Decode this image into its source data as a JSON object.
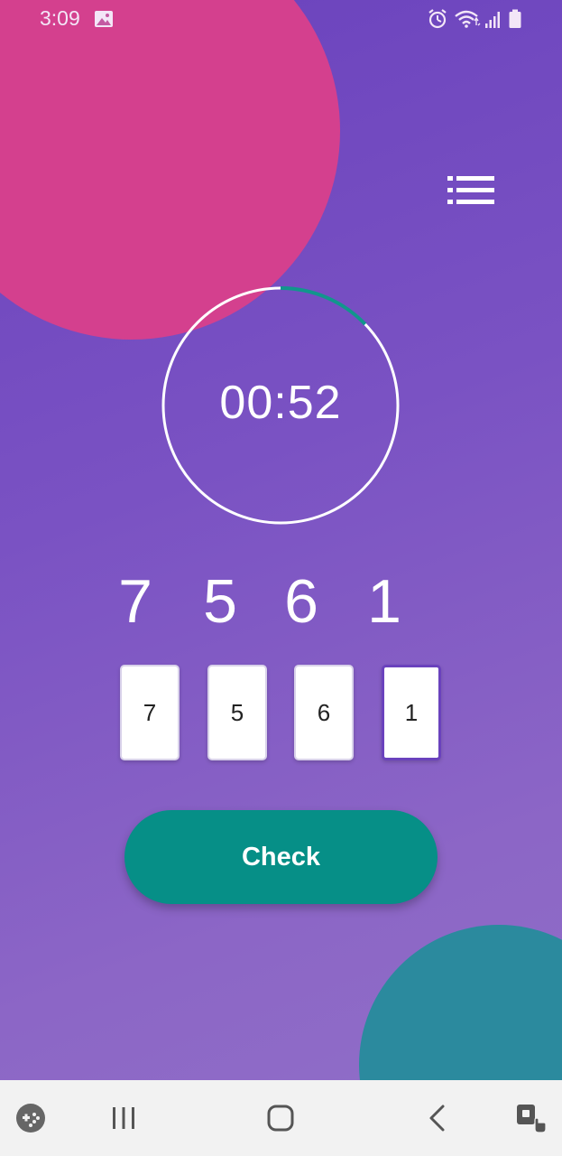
{
  "status_bar": {
    "time": "3:09",
    "icons": [
      "image-icon",
      "alarm-icon",
      "wifi-icon",
      "signal-icon",
      "battery-icon"
    ]
  },
  "menu": {
    "icon": "list-icon"
  },
  "timer": {
    "display": "00:52",
    "ring_color": "#ffffff",
    "progress_color": "#11968c"
  },
  "target_digits": [
    "7",
    "5",
    "6",
    "1"
  ],
  "inputs": [
    {
      "value": "7",
      "focused": false
    },
    {
      "value": "5",
      "focused": false
    },
    {
      "value": "6",
      "focused": false
    },
    {
      "value": "1",
      "focused": true
    }
  ],
  "check_button": {
    "label": "Check",
    "color": "#068f87"
  },
  "nav_bar": {
    "items": [
      "game-launcher-icon",
      "recent-apps-icon",
      "home-icon",
      "back-icon",
      "touch-lock-icon"
    ]
  },
  "colors": {
    "background_start": "#6a42bd",
    "background_end": "#9070c8",
    "pink_blob": "#d4408e",
    "teal_blob": "#2b8a9e"
  }
}
